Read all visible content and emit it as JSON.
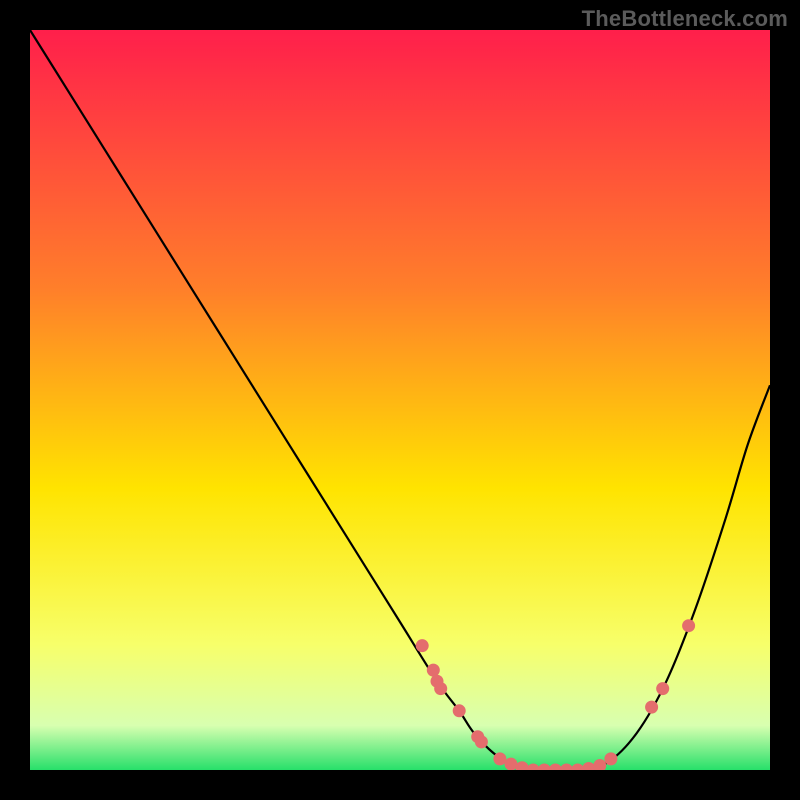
{
  "watermark": "TheBottleneck.com",
  "colors": {
    "gradient_top": "#ff1f4b",
    "gradient_mid_upper": "#ff7f2a",
    "gradient_mid": "#ffe400",
    "gradient_lower": "#f7ff6a",
    "gradient_pale": "#d8ffb0",
    "gradient_bottom": "#27e06a",
    "curve": "#000000",
    "markers": "#e46d6d",
    "frame": "#000000"
  },
  "chart_data": {
    "type": "line",
    "title": "",
    "xlabel": "",
    "ylabel": "",
    "xlim": [
      0,
      100
    ],
    "ylim": [
      0,
      100
    ],
    "grid": false,
    "series": [
      {
        "name": "bottleneck-curve",
        "x": [
          0,
          5,
          10,
          15,
          20,
          25,
          30,
          35,
          40,
          45,
          50,
          55,
          58,
          60,
          63,
          66,
          70,
          74,
          78,
          82,
          86,
          90,
          94,
          97,
          100
        ],
        "y": [
          100,
          92,
          84,
          76,
          68,
          60,
          52,
          44,
          36,
          28,
          20,
          12,
          8,
          5,
          2,
          0.5,
          0,
          0,
          1,
          5,
          12,
          22,
          34,
          44,
          52
        ]
      }
    ],
    "markers": [
      {
        "x": 53.0,
        "y": 16.8
      },
      {
        "x": 54.5,
        "y": 13.5
      },
      {
        "x": 55.0,
        "y": 12.0
      },
      {
        "x": 55.5,
        "y": 11.0
      },
      {
        "x": 58.0,
        "y": 8.0
      },
      {
        "x": 60.5,
        "y": 4.5
      },
      {
        "x": 61.0,
        "y": 3.8
      },
      {
        "x": 63.5,
        "y": 1.5
      },
      {
        "x": 65.0,
        "y": 0.8
      },
      {
        "x": 66.5,
        "y": 0.3
      },
      {
        "x": 68.0,
        "y": 0.0
      },
      {
        "x": 69.5,
        "y": 0.0
      },
      {
        "x": 71.0,
        "y": 0.0
      },
      {
        "x": 72.5,
        "y": 0.0
      },
      {
        "x": 74.0,
        "y": 0.0
      },
      {
        "x": 75.5,
        "y": 0.2
      },
      {
        "x": 77.0,
        "y": 0.6
      },
      {
        "x": 78.5,
        "y": 1.5
      },
      {
        "x": 84.0,
        "y": 8.5
      },
      {
        "x": 85.5,
        "y": 11.0
      },
      {
        "x": 89.0,
        "y": 19.5
      }
    ]
  }
}
